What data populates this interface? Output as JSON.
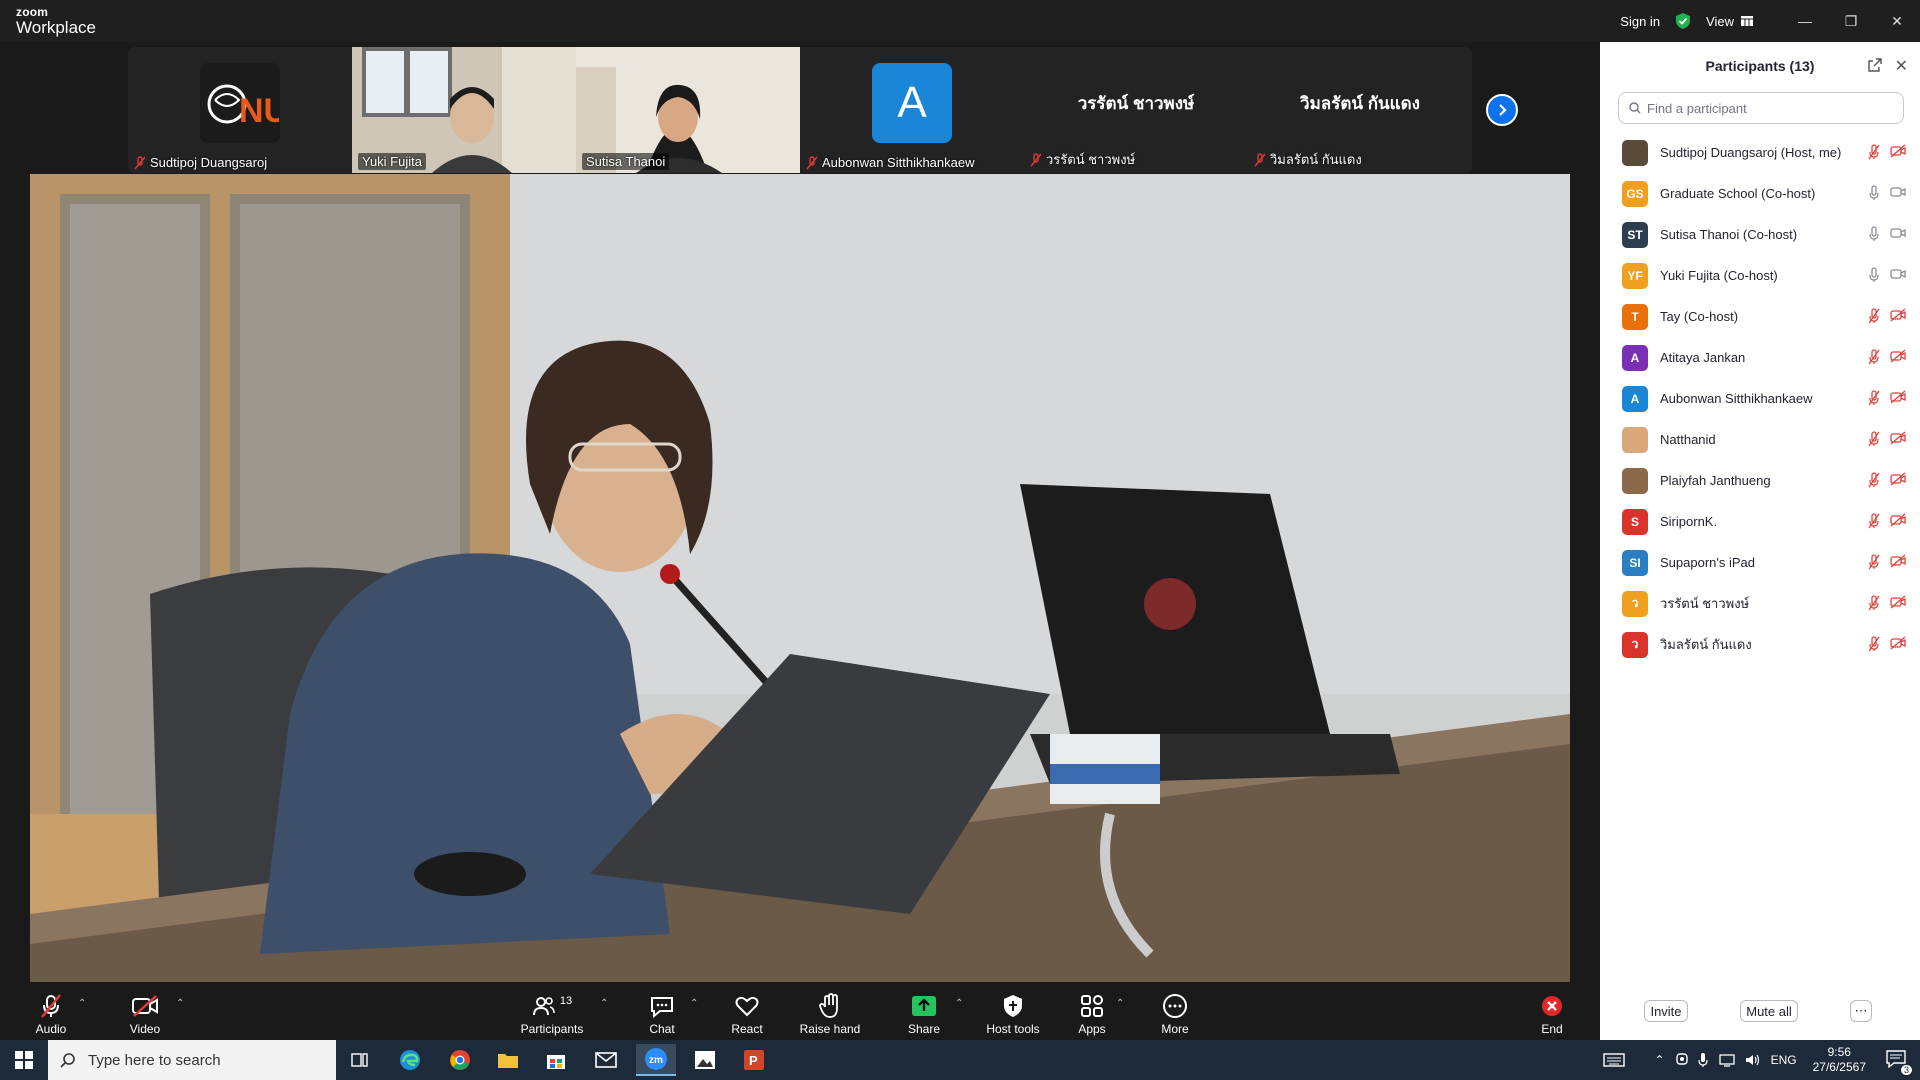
{
  "app": {
    "logo_line1": "zoom",
    "logo_line2": "Workplace",
    "sign_in": "Sign in",
    "view": "View"
  },
  "strip": {
    "tiles": [
      {
        "name": "Sudtipoj Duangsaroj",
        "type": "logo",
        "logo_text": "NU"
      },
      {
        "name": "Yuki Fujita",
        "type": "video"
      },
      {
        "name": "Sutisa Thanoi",
        "type": "video"
      },
      {
        "name": "Aubonwan Sitthikhankaew",
        "type": "avatar",
        "initial": "A"
      },
      {
        "name": "วรรัตน์ ชาวพงษ์",
        "type": "name",
        "big": "วรรัตน์ ชาวพงษ์"
      },
      {
        "name": "วิมลรัตน์ กันแดง",
        "type": "name",
        "big": "วิมลรัตน์ กันแดง"
      }
    ]
  },
  "toolbar": {
    "audio": "Audio",
    "video": "Video",
    "participants": "Participants",
    "participants_count": "13",
    "chat": "Chat",
    "react": "React",
    "raise_hand": "Raise hand",
    "share": "Share",
    "host_tools": "Host tools",
    "apps": "Apps",
    "more": "More",
    "end": "End"
  },
  "panel": {
    "title": "Participants (13)",
    "search_placeholder": "Find a participant",
    "participants": [
      {
        "name": "Sudtipoj Duangsaroj (Host, me)",
        "initials": "",
        "color": "#5a4a3a",
        "muted": true,
        "cam_off": true
      },
      {
        "name": "Graduate School (Co-host)",
        "initials": "GS",
        "color": "#f0a020",
        "muted": false,
        "cam_off": false
      },
      {
        "name": "Sutisa Thanoi (Co-host)",
        "initials": "ST",
        "color": "#2d3e50",
        "muted": false,
        "cam_off": false
      },
      {
        "name": "Yuki Fujita (Co-host)",
        "initials": "YF",
        "color": "#f0a020",
        "muted": false,
        "cam_off": false
      },
      {
        "name": "Tay (Co-host)",
        "initials": "T",
        "color": "#e8710a",
        "muted": true,
        "cam_off": true
      },
      {
        "name": "Atitaya Jankan",
        "initials": "A",
        "color": "#7b2fb5",
        "muted": true,
        "cam_off": true
      },
      {
        "name": "Aubonwan Sitthikhankaew",
        "initials": "A",
        "color": "#1a86d8",
        "muted": true,
        "cam_off": true
      },
      {
        "name": "Natthanid",
        "initials": "",
        "color": "#d9a77a",
        "muted": true,
        "cam_off": true
      },
      {
        "name": "Plaiyfah Janthueng",
        "initials": "",
        "color": "#8a6a4a",
        "muted": true,
        "cam_off": true
      },
      {
        "name": "SiripornK.",
        "initials": "S",
        "color": "#d9342b",
        "muted": true,
        "cam_off": true
      },
      {
        "name": "Supaporn's iPad",
        "initials": "SI",
        "color": "#2a7fc0",
        "muted": true,
        "cam_off": true
      },
      {
        "name": "วรรัตน์ ชาวพงษ์",
        "initials": "ว",
        "color": "#f0a020",
        "muted": true,
        "cam_off": true
      },
      {
        "name": "วิมลรัตน์ กันแดง",
        "initials": "ว",
        "color": "#d9342b",
        "muted": true,
        "cam_off": true
      }
    ],
    "invite": "Invite",
    "mute_all": "Mute all"
  },
  "taskbar": {
    "search_placeholder": "Type here to search",
    "lang": "ENG",
    "time": "9:56",
    "date": "27/6/2567",
    "notif_count": "3"
  }
}
